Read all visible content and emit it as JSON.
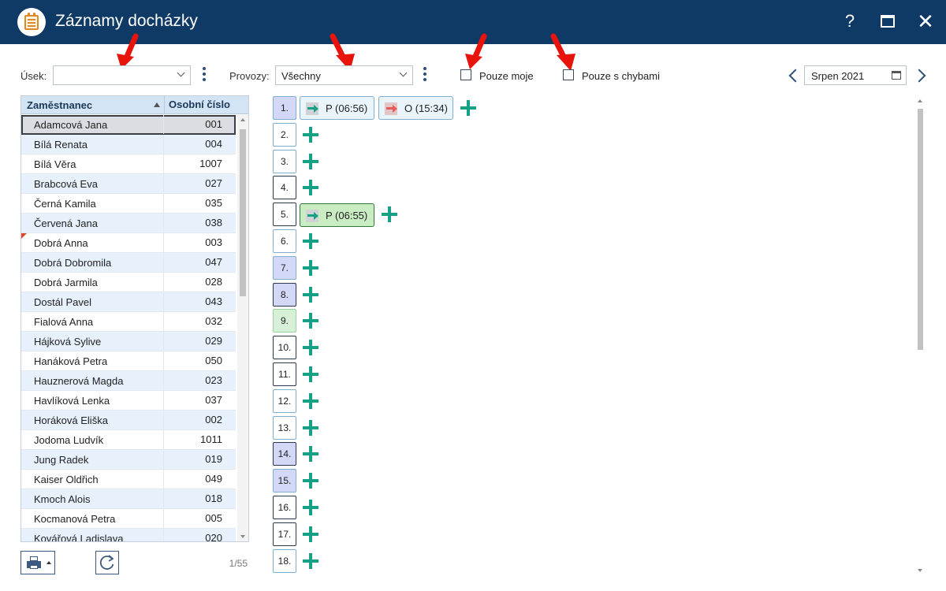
{
  "window": {
    "title": "Záznamy docházky",
    "help_glyph": "?",
    "close_glyph": "✕"
  },
  "filters": {
    "usek_label": "Úsek:",
    "usek_value": "",
    "provozy_label": "Provozy:",
    "provozy_value": "Všechny",
    "pouze_moje_label": "Pouze moje",
    "pouze_s_chybami_label": "Pouze s chybami",
    "period": "Srpen 2021"
  },
  "employees": {
    "col_name": "Zaměstnanec",
    "col_number": "Osobní číslo",
    "rows": [
      {
        "name": "Adamcová Jana",
        "number": "001"
      },
      {
        "name": "Bílá Renata",
        "number": "004"
      },
      {
        "name": "Bílá Věra",
        "number": "1007"
      },
      {
        "name": "Brabcová Eva",
        "number": "027"
      },
      {
        "name": "Černá Kamila",
        "number": "035"
      },
      {
        "name": "Červená Jana",
        "number": "038"
      },
      {
        "name": "Dobrá Anna",
        "number": "003"
      },
      {
        "name": "Dobrá Dobromila",
        "number": "047"
      },
      {
        "name": "Dobrá Jarmila",
        "number": "028"
      },
      {
        "name": "Dostál Pavel",
        "number": "043"
      },
      {
        "name": "Fialová Anna",
        "number": "032"
      },
      {
        "name": "Hájková Sylive",
        "number": "029"
      },
      {
        "name": "Hanáková Petra",
        "number": "050"
      },
      {
        "name": "Hauznerová Magda",
        "number": "023"
      },
      {
        "name": "Havlíková Lenka",
        "number": "037"
      },
      {
        "name": "Horáková Eliška",
        "number": "002"
      },
      {
        "name": "Jodoma Ludvík",
        "number": "1011"
      },
      {
        "name": "Jung Radek",
        "number": "019"
      },
      {
        "name": "Kaiser Oldřich",
        "number": "049"
      },
      {
        "name": "Kmoch Alois",
        "number": "018"
      },
      {
        "name": "Kocmanová Petra",
        "number": "005"
      },
      {
        "name": "Kovářová Ladislava",
        "number": "020"
      }
    ],
    "pager": "1/55"
  },
  "days": [
    {
      "label": "1."
    },
    {
      "label": "2."
    },
    {
      "label": "3."
    },
    {
      "label": "4."
    },
    {
      "label": "5."
    },
    {
      "label": "6."
    },
    {
      "label": "7."
    },
    {
      "label": "8."
    },
    {
      "label": "9."
    },
    {
      "label": "10."
    },
    {
      "label": "11."
    },
    {
      "label": "12."
    },
    {
      "label": "13."
    },
    {
      "label": "14."
    },
    {
      "label": "15."
    },
    {
      "label": "16."
    },
    {
      "label": "17."
    },
    {
      "label": "18."
    }
  ],
  "records": {
    "day1_in": "P (06:56)",
    "day1_out": "O (15:34)",
    "day5_in": "P (06:55)"
  },
  "colors": {
    "titlebar": "#0f3a66",
    "accent": "#16a085",
    "annotation_arrow": "#e8140c"
  }
}
